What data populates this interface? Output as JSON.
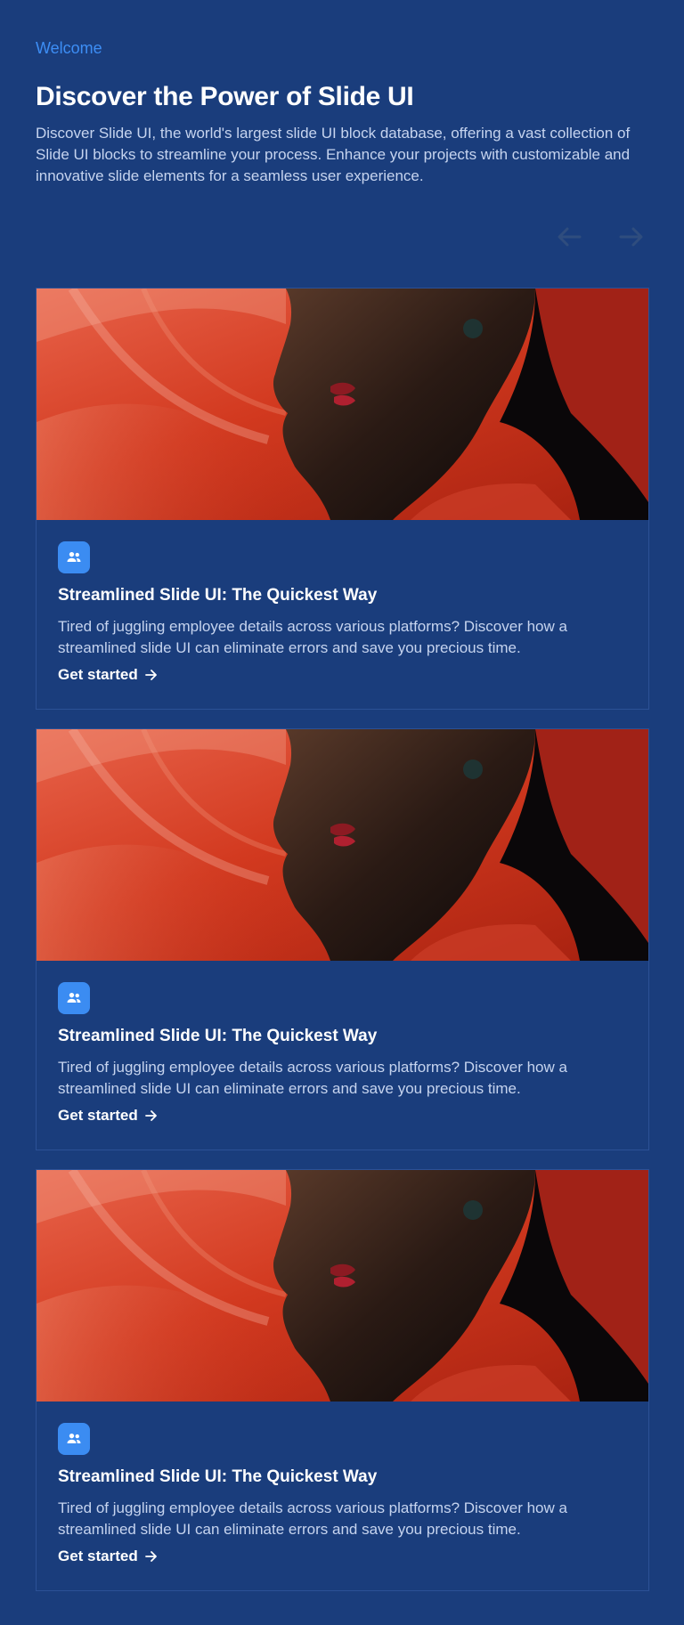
{
  "header": {
    "eyebrow": "Welcome",
    "title": "Discover the Power of Slide UI",
    "intro": "Discover Slide UI, the world's largest slide UI block database, offering a vast collection of Slide UI blocks to streamline your process. Enhance your projects with customizable and innovative slide elements for a seamless user experience."
  },
  "nav": {
    "prev_icon": "arrow-left-icon",
    "next_icon": "arrow-right-icon"
  },
  "cards": [
    {
      "icon": "users-icon",
      "title": "Streamlined Slide UI: The Quickest Way",
      "description": "Tired of juggling employee details across various platforms? Discover how a streamlined slide UI can eliminate errors and save you precious time.",
      "link": "Get started"
    },
    {
      "icon": "users-icon",
      "title": "Streamlined Slide UI: The Quickest Way",
      "description": "Tired of juggling employee details across various platforms? Discover how a streamlined slide UI can eliminate errors and save you precious time.",
      "link": "Get started"
    },
    {
      "icon": "users-icon",
      "title": "Streamlined Slide UI: The Quickest Way",
      "description": "Tired of juggling employee details across various platforms? Discover how a streamlined slide UI can eliminate errors and save you precious time.",
      "link": "Get started"
    }
  ],
  "colors": {
    "background": "#1a3d7c",
    "accent": "#3d8ef5",
    "icon_bg": "#3b8cf2",
    "body_text": "#c6d4ef"
  }
}
